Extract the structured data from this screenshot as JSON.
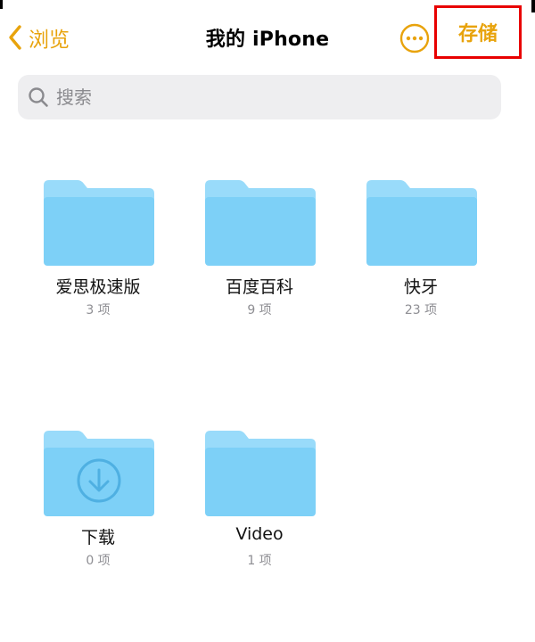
{
  "nav": {
    "back_label": "浏览",
    "title": "我的 iPhone",
    "more_icon": "ellipsis-circle-icon",
    "save_label": "存储"
  },
  "search": {
    "placeholder": "搜索",
    "icon": "magnifier-icon"
  },
  "folders": [
    {
      "name": "爱思极速版",
      "count": "3 项",
      "icon": "folder-icon"
    },
    {
      "name": "百度百科",
      "count": "9 项",
      "icon": "folder-icon"
    },
    {
      "name": "快牙",
      "count": "23 项",
      "icon": "folder-icon"
    },
    {
      "name": "下载",
      "count": "0 项",
      "icon": "download-folder-icon"
    },
    {
      "name": "Video",
      "count": "1 项",
      "icon": "folder-icon"
    }
  ],
  "colors": {
    "accent": "#E8A30C",
    "highlight_box": "#E80000",
    "folder_fill": "#7DD0F7",
    "folder_tab": "#99DBFA",
    "search_bg": "#EEEEF0",
    "secondary_text": "#8E8E93"
  }
}
